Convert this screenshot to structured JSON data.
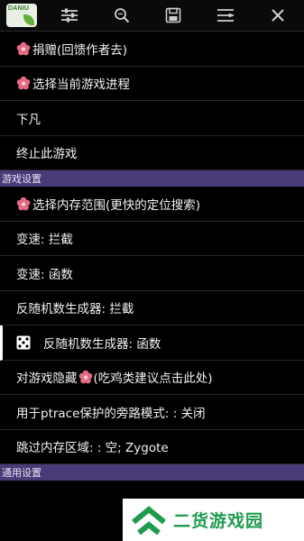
{
  "toolbar": {
    "logo_text": "DANIU",
    "icons": [
      "sliders-icon",
      "search-icon",
      "save-icon",
      "list-settings-icon",
      "close-icon"
    ]
  },
  "menu_top": [
    {
      "label": "捐赠(回馈作者去)",
      "icon": "flower-icon"
    },
    {
      "label": "选择当前游戏进程",
      "icon": "flower-icon"
    },
    {
      "label": "下凡",
      "icon": ""
    },
    {
      "label": "终止此游戏",
      "icon": ""
    }
  ],
  "section_game": "游戏设置",
  "menu_game": [
    {
      "label": "选择内存范围(更快的定位搜索)",
      "icon": "flower-icon"
    },
    {
      "label": "变速: 拦截",
      "icon": ""
    },
    {
      "label": "变速: 函数",
      "icon": ""
    },
    {
      "label": "反随机数生成器: 拦截",
      "icon": ""
    },
    {
      "label": "反随机数生成器: 函数",
      "icon": "dice-icon"
    },
    {
      "label_before": "对游戏隐藏",
      "label_after": "(吃鸡类建议点击此处)",
      "icon": "flower-icon"
    },
    {
      "label": "用于ptrace保护的旁路模式: : 关闭",
      "icon": ""
    },
    {
      "label": "跳过内存区域: : 空; Zygote",
      "icon": ""
    }
  ],
  "section_general": "通用设置",
  "watermark": {
    "text": "二货游戏园"
  },
  "colors": {
    "section_bg": "#4b3a78",
    "background": "#000000",
    "watermark_green": "#1f9b4e"
  }
}
